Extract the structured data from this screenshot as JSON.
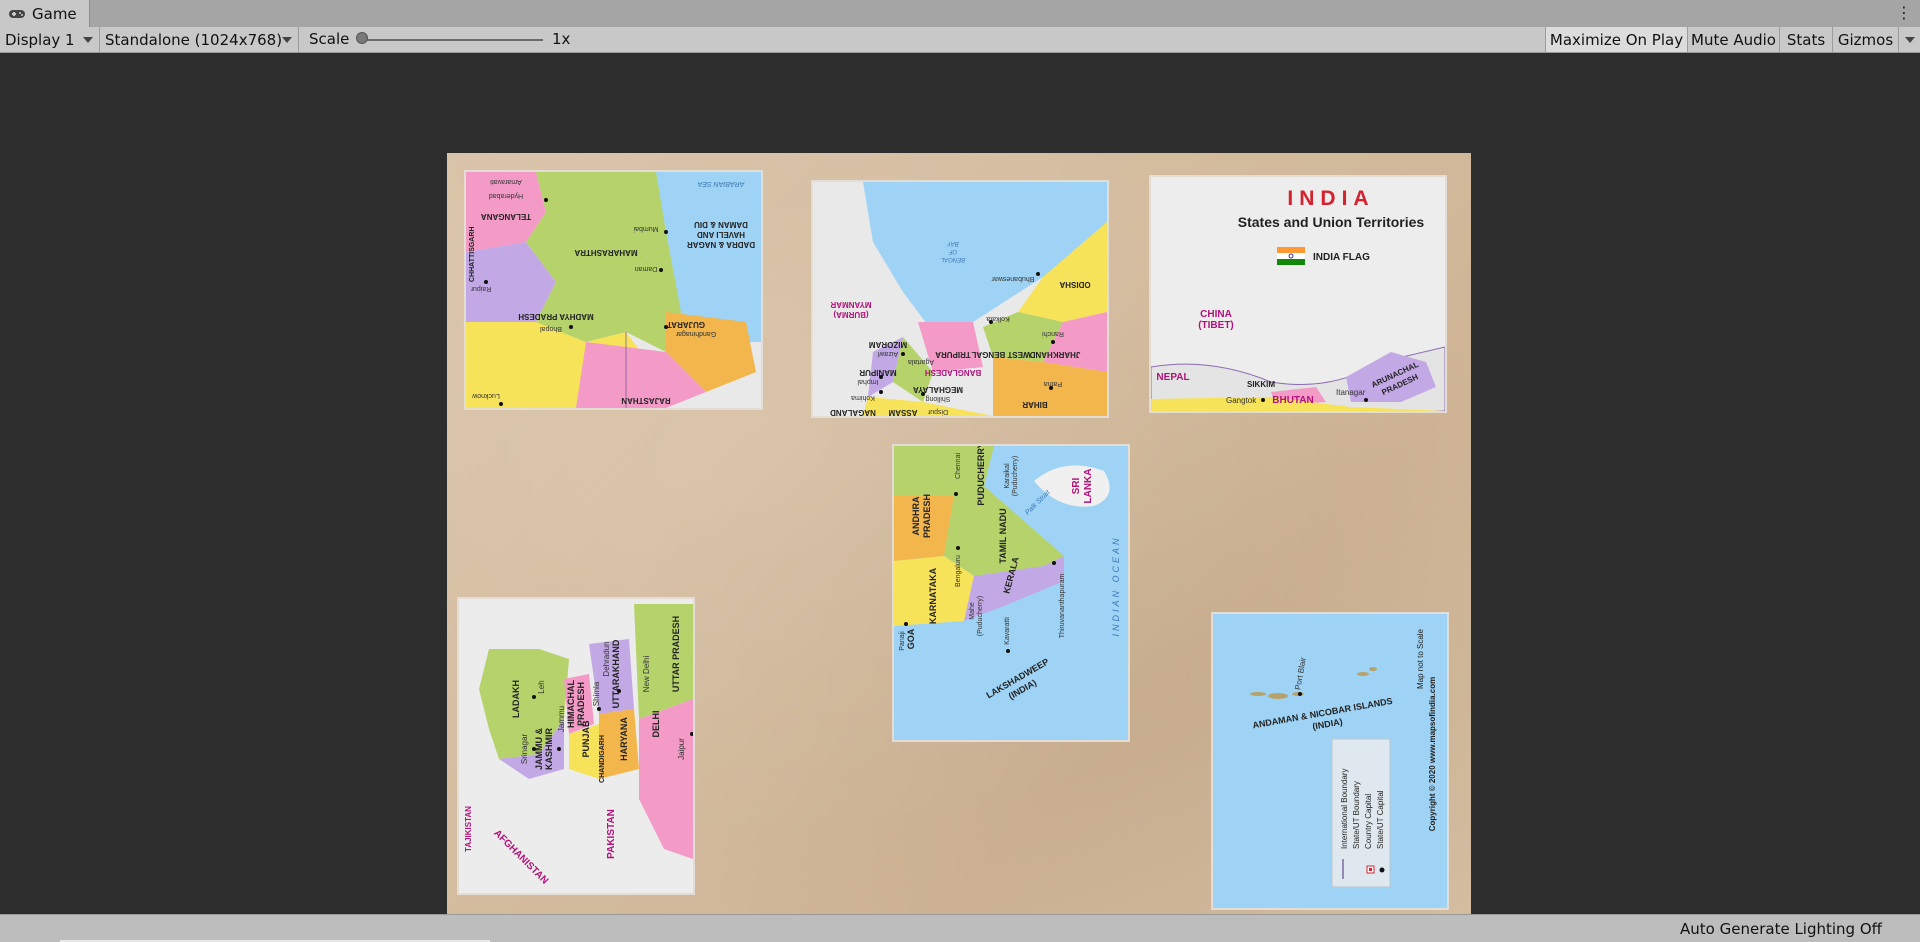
{
  "window": {
    "tab_title": "Game",
    "menu_glyph": "⋮"
  },
  "toolbar": {
    "display": "Display 1",
    "resolution": "Standalone (1024x768)",
    "scale_label": "Scale",
    "scale_value": "1x",
    "scale_level": 0.0,
    "maximize": "Maximize On Play",
    "mute": "Mute Audio",
    "stats": "Stats",
    "gizmos": "Gizmos"
  },
  "status": {
    "lighting": "Auto Generate Lighting Off"
  },
  "pieces": {
    "p1": {
      "labels": [
        "MAHARASHTRA",
        "MADHYA PRADESH",
        "TELANGANA",
        "GUJARAT",
        "RAJASTHAN",
        "DADRA & NAGAR HAVELI AND DAMAN & DIU",
        "Mumbai",
        "Bhopal",
        "Gandhinagar",
        "Daman",
        "Hyderabad",
        "Raipur",
        "Lucknow",
        "CHHATTISGARH",
        "ARABIAN SEA",
        "Amaravati"
      ]
    },
    "p2": {
      "labels": [
        "MYANMAR (BURMA)",
        "ODISHA",
        "WEST BENGAL",
        "JHARKHAND",
        "BIHAR",
        "BANGLADESH",
        "MEGHALAYA",
        "TRIPURA",
        "MIZORAM",
        "MANIPUR",
        "NAGALAND",
        "ASSAM",
        "BAY OF BENGAL",
        "Bhubaneswar",
        "Kolkata",
        "Ranchi",
        "Patna",
        "Agartala",
        "Aizawl",
        "Imphal",
        "Kohima",
        "Shillong",
        "Dispur"
      ]
    },
    "p3": {
      "title": "INDIA",
      "subtitle": "States and Union Territories",
      "flag_label": "INDIA FLAG",
      "labels": [
        "CHINA (TIBET)",
        "NEPAL",
        "SIKKIM",
        "BHUTAN",
        "ARUNACHAL PRADESH",
        "Gangtok",
        "Itanagar"
      ]
    },
    "p4": {
      "labels": [
        "ANDHRA PRADESH",
        "KARNATAKA",
        "TAMIL NADU",
        "KERALA",
        "PUDUCHERRY",
        "SRI LANKA",
        "GOA",
        "LAKSHADWEEP (INDIA)",
        "INDIAN OCEAN",
        "Chennai",
        "Bengaluru",
        "Thiruvananthapuram",
        "Kavaratti",
        "Panaji",
        "Mahe (Puducherry)",
        "Karaikal (Puducherry)",
        "Palk Strait"
      ]
    },
    "p5": {
      "labels": [
        "LADAKH",
        "JAMMU & KASHMIR",
        "HIMACHAL PRADESH",
        "PUNJAB",
        "UTTARAKHAND",
        "HARYANA",
        "DELHI",
        "UTTAR PRADESH",
        "CHANDIGARH",
        "PAKISTAN",
        "AFGHANISTAN",
        "TAJIKISTAN",
        "Leh",
        "Srinagar",
        "Jammu",
        "Shimla",
        "Dehradun",
        "New Delhi",
        "Jaipur"
      ]
    },
    "p6": {
      "labels": [
        "ANDAMAN & NICOBAR ISLANDS (INDIA)",
        "Port Blair",
        "Map not to Scale",
        "Copyright © 2020 www.mapsofindia.com",
        "International Boundary",
        "State/UT Boundary",
        "Country Capital",
        "State/UT Capital"
      ]
    }
  }
}
